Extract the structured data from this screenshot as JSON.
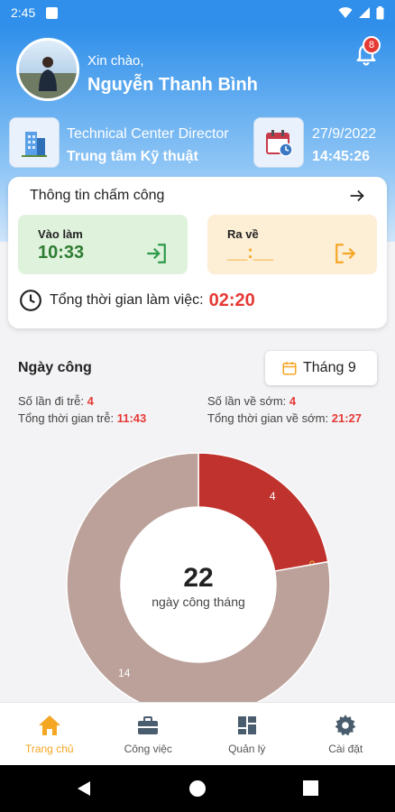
{
  "status_bar": {
    "time": "2:45"
  },
  "header": {
    "greeting": "Xin chào,",
    "user_name": "Nguyễn Thanh Bình",
    "notification_count": "8",
    "role": "Technical Center Director",
    "department": "Trung tâm Kỹ thuật",
    "date": "27/9/2022",
    "time": "14:45:26"
  },
  "attendance": {
    "title": "Thông tin chấm công",
    "check_in_label": "Vào làm",
    "check_in_value": "10:33",
    "check_out_label": "Ra về",
    "check_out_value": "__:__",
    "total_label": "Tổng thời gian làm việc:",
    "total_value": "02:20"
  },
  "workdays": {
    "title": "Ngày công",
    "month_button": "Tháng 9",
    "late_count_label": "Số lần đi trễ:",
    "late_count": "4",
    "late_time_label": "Tổng thời gian trễ:",
    "late_time": "11:43",
    "early_count_label": "Số lần về sớm:",
    "early_count": "4",
    "early_time_label": "Tổng thời gian về sớm:",
    "early_time": "21:27"
  },
  "chart_data": {
    "type": "pie",
    "center_value": "22",
    "center_label": "ngày công tháng",
    "slices": [
      {
        "value": 4,
        "label": "4",
        "color": "#c0322d"
      },
      {
        "value": 0,
        "label": "0",
        "color": "#e8c04a"
      },
      {
        "value": 14,
        "label": "14",
        "color": "#bba19a"
      }
    ]
  },
  "tabs": [
    {
      "label": "Trang chủ",
      "icon": "home-icon",
      "active": true
    },
    {
      "label": "Công việc",
      "icon": "briefcase-icon",
      "active": false
    },
    {
      "label": "Quản lý",
      "icon": "dashboard-icon",
      "active": false
    },
    {
      "label": "Cài đặt",
      "icon": "gear-icon",
      "active": false
    }
  ],
  "colors": {
    "primary": "#2f8fea",
    "accent": "#f5a623",
    "danger": "#e53935",
    "success": "#2e7d32"
  }
}
